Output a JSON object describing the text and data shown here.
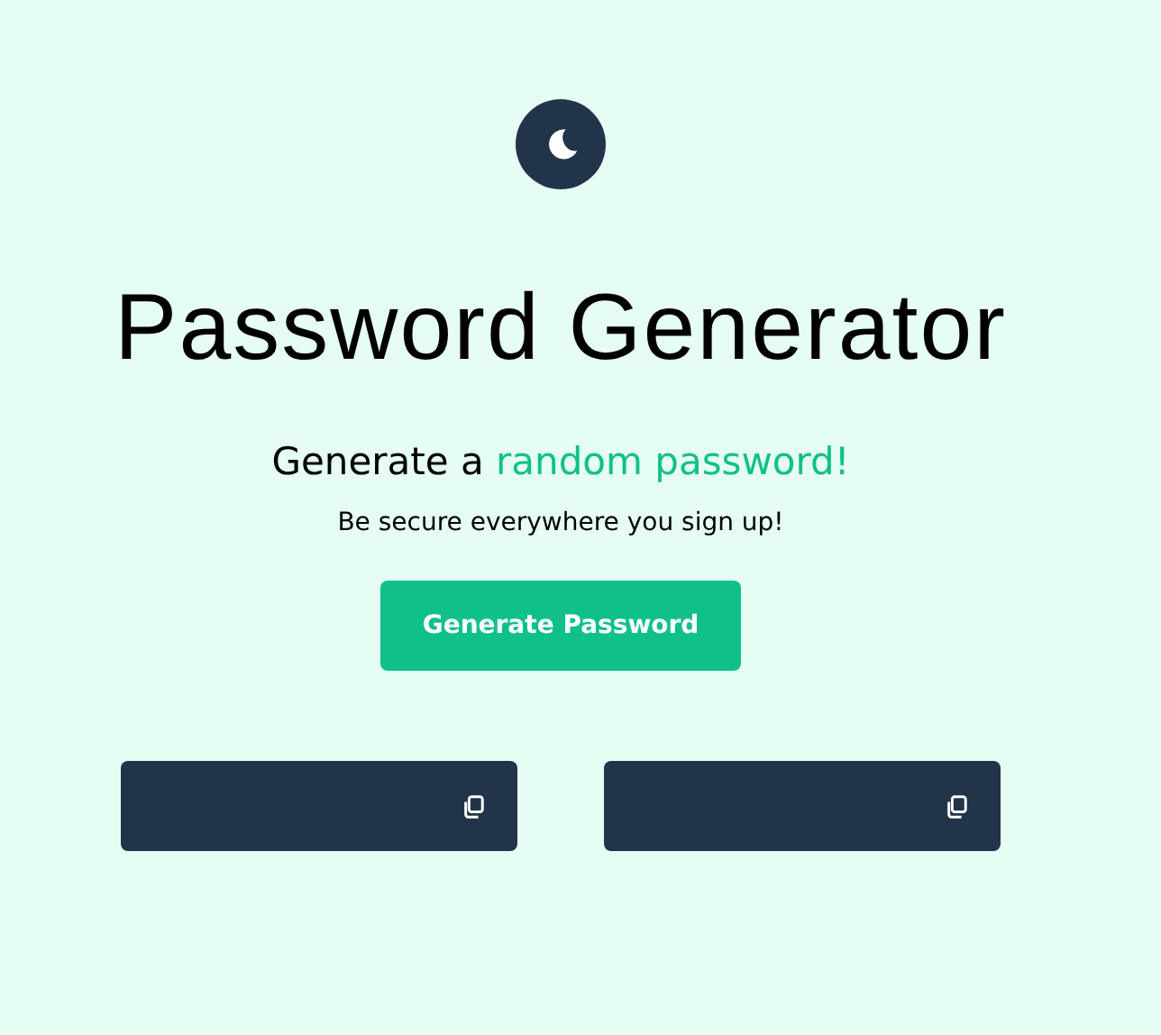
{
  "title": "Password Generator",
  "subtitle": {
    "text": "Generate a",
    "highlight": "random password!"
  },
  "tagline": "Be secure everywhere you sign up!",
  "generate_button": {
    "label": "Generate Password"
  },
  "password_fields": [
    {
      "kind": "password"
    },
    {
      "kind": "password"
    }
  ]
}
